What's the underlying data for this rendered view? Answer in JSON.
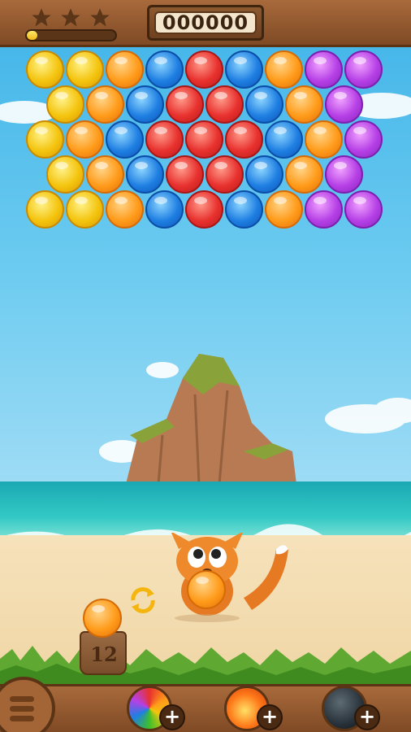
{
  "hud": {
    "score": "000000",
    "stars_earned": 0,
    "stars_total": 3,
    "progress_percent": 12
  },
  "board": {
    "rows": [
      [
        "yellow",
        "yellow",
        "orange",
        "blue",
        "red",
        "blue",
        "orange",
        "purple",
        "purple"
      ],
      [
        "yellow",
        "orange",
        "blue",
        "red",
        "red",
        "blue",
        "orange",
        "purple"
      ],
      [
        "yellow",
        "orange",
        "blue",
        "red",
        "red",
        "red",
        "blue",
        "orange",
        "purple"
      ],
      [
        "yellow",
        "orange",
        "blue",
        "red",
        "red",
        "blue",
        "orange",
        "purple"
      ],
      [
        "yellow",
        "yellow",
        "orange",
        "blue",
        "red",
        "blue",
        "orange",
        "purple",
        "purple"
      ]
    ]
  },
  "shooter": {
    "current_bubble": "orange",
    "next_bubble": "orange",
    "shots_remaining": "12"
  },
  "powerups": [
    {
      "name": "rainbow-bubble",
      "icon": "rainbow-bubble-icon"
    },
    {
      "name": "fire-bubble",
      "icon": "fire-bubble-icon"
    },
    {
      "name": "bomb-bubble",
      "icon": "bomb-icon"
    }
  ],
  "colors": {
    "wood": "#8f5a30",
    "sea": "#2bbfc0",
    "sand": "#f3dcaf"
  }
}
